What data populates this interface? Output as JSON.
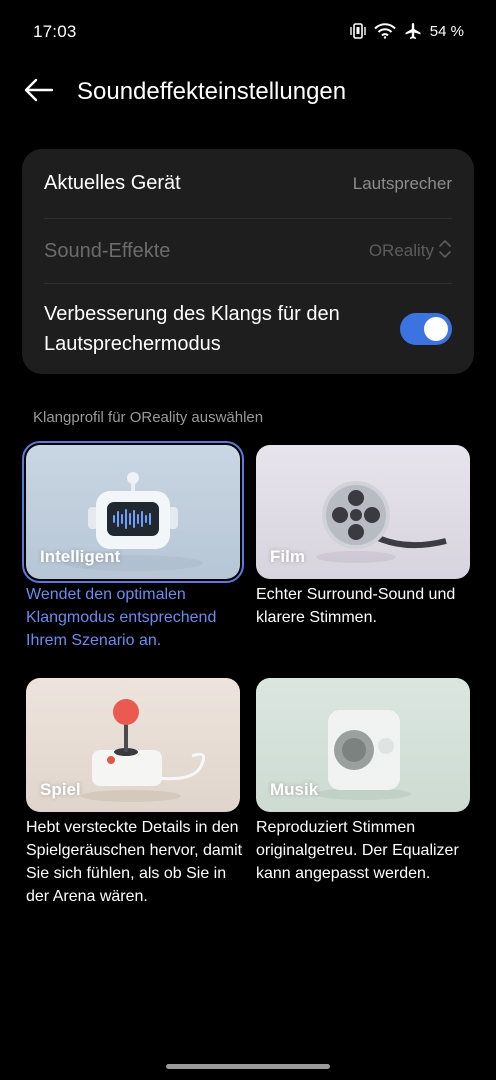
{
  "status_bar": {
    "time": "17:03",
    "battery": "54 %",
    "icons": [
      "vibrate-icon",
      "wifi-icon",
      "airplane-icon"
    ]
  },
  "header": {
    "title": "Soundeffekteinstellungen",
    "back_icon": "arrow-left-icon"
  },
  "settings": {
    "current_device_label": "Aktuelles Gerät",
    "current_device_value": "Lautsprecher",
    "sound_effects_label": "Sound-Effekte",
    "sound_effects_value": "OReality",
    "enhancement_label": "Verbesserung des Klangs für den Lautsprechermodus",
    "enhancement_enabled": true
  },
  "profiles": {
    "section_title": "Klangprofil für OReality auswählen",
    "items": [
      {
        "label": "Intelligent",
        "description": "Wendet den optimalen Klangmodus entsprechend Ihrem Szenario an.",
        "selected": true
      },
      {
        "label": "Film",
        "description": "Echter Surround-Sound und klarere Stimmen.",
        "selected": false
      },
      {
        "label": "Spiel",
        "description": "Hebt versteckte Details in den Spielgeräuschen hervor, damit Sie sich fühlen, als ob Sie in der Arena wären.",
        "selected": false
      },
      {
        "label": "Musik",
        "description": "Reproduziert Stimmen originalgetreu. Der Equalizer kann angepasst werden.",
        "selected": false
      }
    ]
  },
  "colors": {
    "accent": "#3b74e0",
    "selected_text": "#6a8cf0",
    "card_bg": "#1e1e1e"
  }
}
